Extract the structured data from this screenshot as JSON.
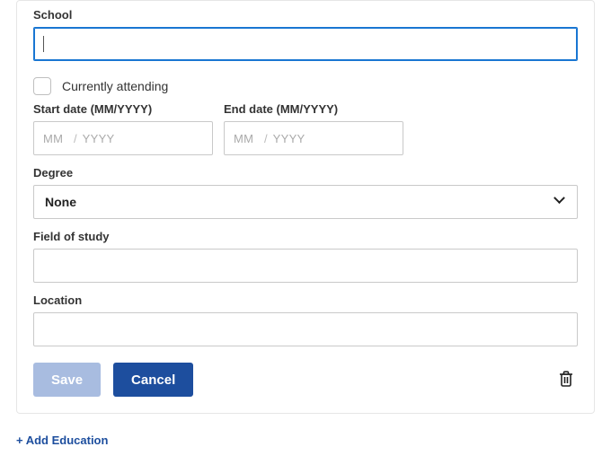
{
  "labels": {
    "school": "School",
    "currently_attending": "Currently attending",
    "start_date": "Start date (MM/YYYY)",
    "end_date": "End date (MM/YYYY)",
    "degree": "Degree",
    "field_of_study": "Field of study",
    "location": "Location"
  },
  "placeholders": {
    "mm": "MM",
    "yyyy": "YYYY"
  },
  "values": {
    "school": "",
    "currently_attending": false,
    "start_mm": "",
    "start_yyyy": "",
    "end_mm": "",
    "end_yyyy": "",
    "degree_selected": "None",
    "field_of_study": "",
    "location": ""
  },
  "buttons": {
    "save": "Save",
    "cancel": "Cancel",
    "add_education": "+ Add Education"
  }
}
